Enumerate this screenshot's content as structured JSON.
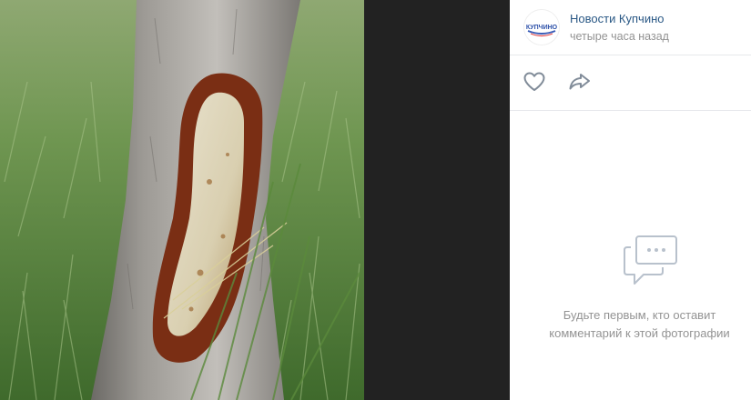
{
  "post": {
    "author_name": "Новости Купчино",
    "time": "четыре часа назад",
    "avatar_text": "КУПЧИНО"
  },
  "actions": {
    "like_icon": "heart-icon",
    "share_icon": "share-arrow-icon"
  },
  "comments": {
    "empty_icon": "comment-bubble-icon",
    "empty_line1": "Будьте первым, кто оставит",
    "empty_line2": "комментарий к этой фотографии"
  },
  "colors": {
    "link": "#2a5885",
    "muted": "#939393",
    "divider": "#e7e8ec",
    "icon": "#818c99"
  }
}
